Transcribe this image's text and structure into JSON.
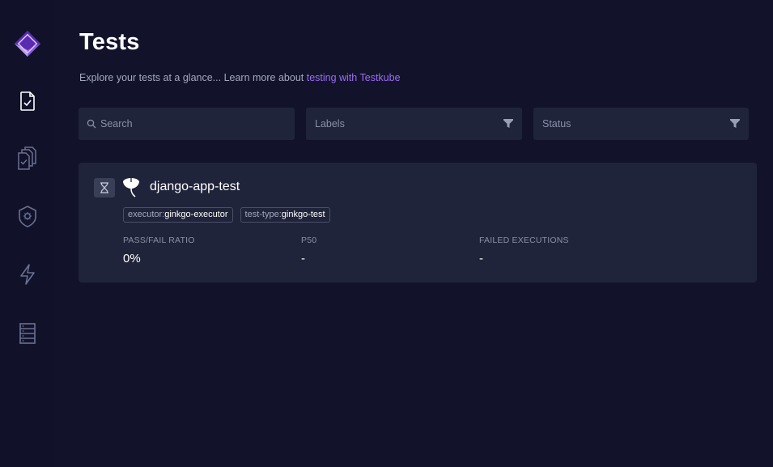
{
  "page": {
    "title": "Tests",
    "subtitle_text": "Explore your tests at a glance... Learn more about ",
    "subtitle_link": "testing with Testkube"
  },
  "sidebar": {
    "logo_icon": "testkube-cube-logo",
    "items": [
      {
        "icon": "test-document-icon",
        "active": true
      },
      {
        "icon": "test-suites-icon",
        "active": false
      },
      {
        "icon": "executors-shield-icon",
        "active": false
      },
      {
        "icon": "triggers-lightning-icon",
        "active": false
      },
      {
        "icon": "sources-server-icon",
        "active": false
      }
    ]
  },
  "filters": {
    "search_placeholder": "Search",
    "labels_placeholder": "Labels",
    "status_placeholder": "Status"
  },
  "tests": [
    {
      "name": "django-app-test",
      "status_icon": "hourglass-icon",
      "type_icon": "ginkgo-leaf-icon",
      "tags": [
        {
          "key": "executor:",
          "value": "ginkgo-executor"
        },
        {
          "key": "test-type:",
          "value": "ginkgo-test"
        }
      ],
      "metrics": {
        "pass_fail_label": "PASS/FAIL RATIO",
        "pass_fail_value": "0%",
        "p50_label": "P50",
        "p50_value": "-",
        "failed_label": "FAILED EXECUTIONS",
        "failed_value": "-"
      }
    }
  ],
  "colors": {
    "background": "#12132b",
    "panel": "#20243a",
    "accent": "#9b6cf5",
    "muted_text": "#8b8fa8"
  }
}
